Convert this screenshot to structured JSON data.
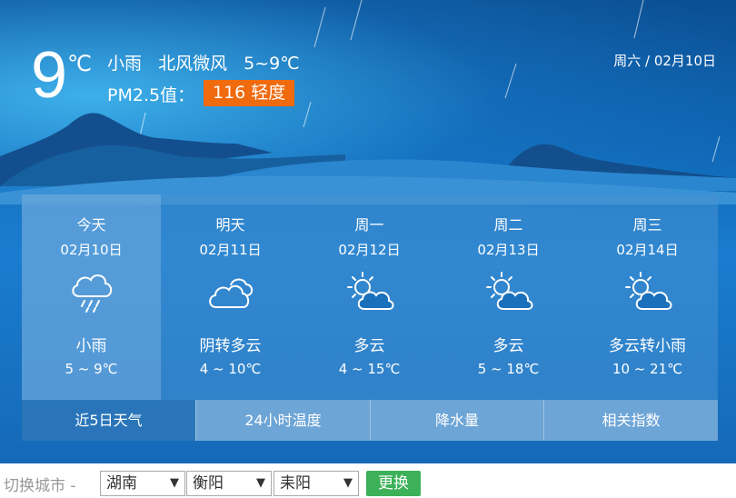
{
  "current": {
    "temp": "9",
    "unit": "℃",
    "condition": "小雨",
    "wind": "北风微风",
    "range": "5~9℃",
    "pm_label": "PM2.5值：",
    "pm_value": "116 轻度",
    "pm_color": "#f06a0e",
    "date": "周六 / 02月10日"
  },
  "forecast": [
    {
      "name": "今天",
      "date": "02月10日",
      "icon": "rain-cloud-icon",
      "cond": "小雨",
      "range": "5 ~ 9℃"
    },
    {
      "name": "明天",
      "date": "02月11日",
      "icon": "overcast-cloud-icon",
      "cond": "阴转多云",
      "range": "4 ~ 10℃"
    },
    {
      "name": "周一",
      "date": "02月12日",
      "icon": "partly-cloudy-icon",
      "cond": "多云",
      "range": "4 ~ 15℃"
    },
    {
      "name": "周二",
      "date": "02月13日",
      "icon": "partly-cloudy-icon",
      "cond": "多云",
      "range": "5 ~ 18℃"
    },
    {
      "name": "周三",
      "date": "02月14日",
      "icon": "partly-cloudy-icon",
      "cond": "多云转小雨",
      "range": "10 ~ 21℃"
    }
  ],
  "tabs": [
    {
      "label": "近5日天气",
      "active": true
    },
    {
      "label": "24小时温度",
      "active": false
    },
    {
      "label": "降水量",
      "active": false
    },
    {
      "label": "相关指数",
      "active": false
    }
  ],
  "footer": {
    "label": "切换城市 -",
    "province": "湖南",
    "city": "衡阳",
    "county": "耒阳",
    "button": "更换",
    "button_color": "#3cb158"
  }
}
